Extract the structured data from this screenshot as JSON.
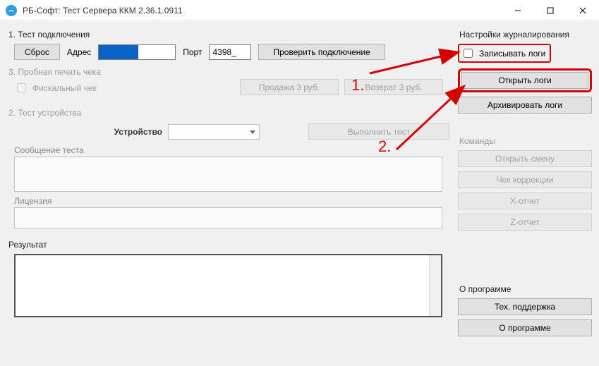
{
  "window": {
    "title": "РБ-Софт: Тест Сервера ККМ 2.36.1.0911"
  },
  "section1": {
    "label": "1. Тест подключения",
    "reset": "Сброс",
    "address_label": "Адрес",
    "port_label": "Порт",
    "port_value": "4398_",
    "check": "Проверить подключение"
  },
  "section3": {
    "label": "3. Пробная печать чека",
    "fiscal": "Фискальный чек",
    "sale": "Продажа 3 руб.",
    "refund": "Возврат 3 руб."
  },
  "section2": {
    "label": "2. Тест устройства",
    "device_label": "Устройство",
    "run": "Выполнить тест",
    "msg_label": "Сообщение теста",
    "lic_label": "Лицензия"
  },
  "result": {
    "label": "Результат"
  },
  "logging": {
    "label": "Настройки журналирования",
    "write_logs": "Записывать логи",
    "open_logs": "Открыть логи",
    "archive_logs": "Архивировать логи"
  },
  "commands": {
    "label": "Команды",
    "open_shift": "Открыть смену",
    "correction": "Чек коррекции",
    "xreport": "X-отчет",
    "zreport": "Z-отчет"
  },
  "about": {
    "label": "О программе",
    "support": "Тех. поддержка",
    "about_btn": "О программе"
  },
  "annotations": {
    "n1": "1.",
    "n2": "2."
  }
}
